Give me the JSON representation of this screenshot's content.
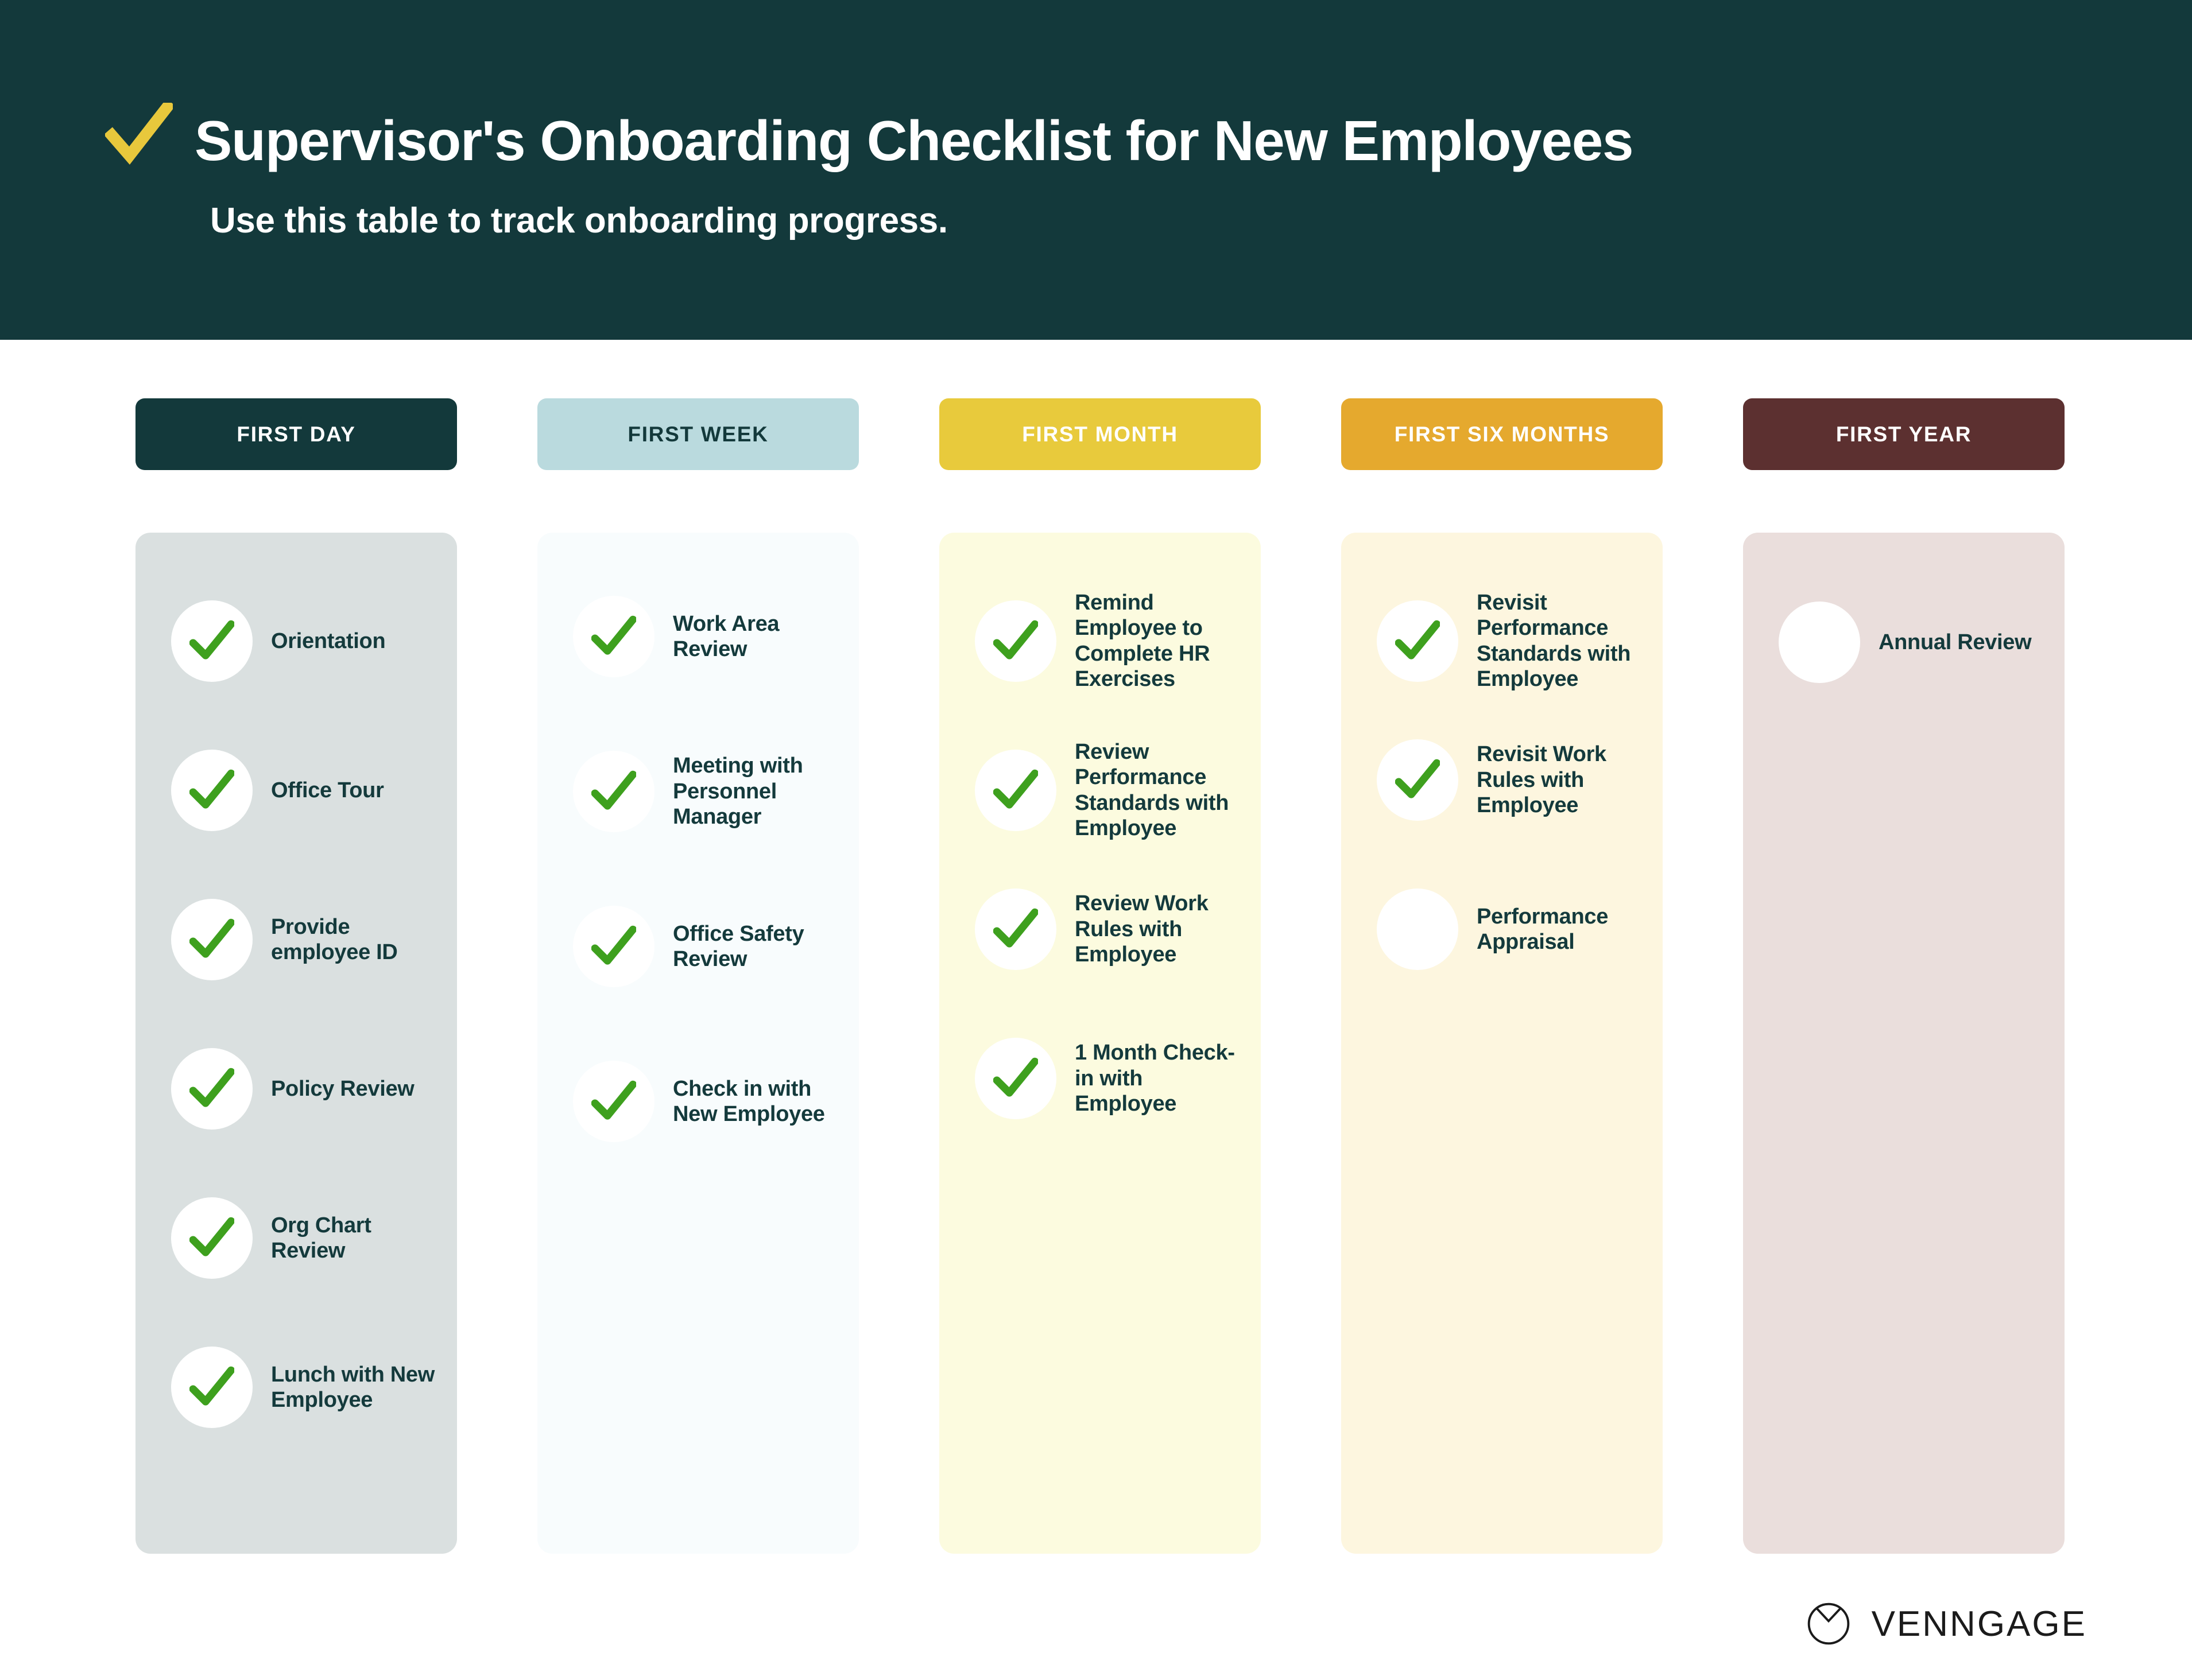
{
  "header": {
    "title": "Supervisor's Onboarding Checklist for New Employees",
    "subtitle": "Use this table to track onboarding progress.",
    "check_icon": "check-icon",
    "background_color": "#13393B",
    "check_color": "#E8C83C",
    "text_color": "#FFFFFF"
  },
  "colors": {
    "checkmark_green": "#3EA01E",
    "body_text": "#143A3C",
    "page_background": "#FFFFFF"
  },
  "columns": [
    {
      "header_label": "FIRST DAY",
      "header_bg": "#13393B",
      "header_text_color": "#FFFFFF",
      "body_bg": "#DAE0E0",
      "items": [
        {
          "label": "Orientation",
          "checked": true
        },
        {
          "label": "Office Tour",
          "checked": true
        },
        {
          "label": "Provide employee ID",
          "checked": true
        },
        {
          "label": "Policy Review",
          "checked": true
        },
        {
          "label": "Org Chart Review",
          "checked": true
        },
        {
          "label": "Lunch with New Employee",
          "checked": true
        }
      ]
    },
    {
      "header_label": "FIRST WEEK",
      "header_bg": "#BADADE",
      "header_text_color": "#13393B",
      "body_bg": "#F8FCFD",
      "items": [
        {
          "label": "Work Area Review",
          "checked": true
        },
        {
          "label": "Meeting with Personnel Manager",
          "checked": true
        },
        {
          "label": "Office Safety Review",
          "checked": true
        },
        {
          "label": "Check in with New Employee",
          "checked": true
        }
      ]
    },
    {
      "header_label": "FIRST MONTH",
      "header_bg": "#E8CA3C",
      "header_text_color": "#FFFFFF",
      "body_bg": "#FCFBDF",
      "items": [
        {
          "label": "Remind Employee to Complete HR Exercises",
          "checked": true
        },
        {
          "label": "Review Performance Standards with Employee",
          "checked": true
        },
        {
          "label": "Review Work Rules with Employee",
          "checked": true
        },
        {
          "label": "1 Month Check-in with Employee",
          "checked": true
        }
      ]
    },
    {
      "header_label": "FIRST SIX MONTHS",
      "header_bg": "#E5A92E",
      "header_text_color": "#FFFFFF",
      "body_bg": "#FDF6DF",
      "items": [
        {
          "label": "Revisit Performance Standards with Employee",
          "checked": true
        },
        {
          "label": "Revisit Work Rules with Employee",
          "checked": true
        },
        {
          "label": "Performance Appraisal",
          "checked": false
        }
      ]
    },
    {
      "header_label": "FIRST YEAR",
      "header_bg": "#5C3030",
      "header_text_color": "#FFFFFF",
      "body_bg": "#EADEDC",
      "items": [
        {
          "label": "Annual Review",
          "checked": false
        }
      ]
    }
  ],
  "footer": {
    "brand": "VENNGAGE",
    "logo_icon": "venngage-logo-icon"
  }
}
